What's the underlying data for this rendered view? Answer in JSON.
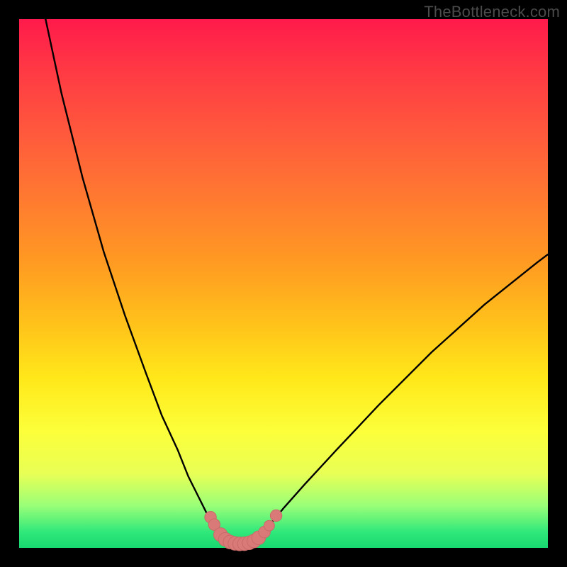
{
  "watermark": "TheBottleneck.com",
  "colors": {
    "frame": "#000000",
    "curve_stroke": "#000000",
    "marker_fill": "#d97a78",
    "marker_stroke": "#c96a68"
  },
  "chart_data": {
    "type": "line",
    "title": "",
    "xlabel": "",
    "ylabel": "",
    "xlim": [
      0,
      100
    ],
    "ylim": [
      0,
      100
    ],
    "grid": false,
    "legend": false,
    "series": [
      {
        "name": "left-branch",
        "x": [
          5,
          8,
          12,
          16,
          20,
          24,
          27,
          30,
          32,
          34,
          35.5,
          37,
          38.2,
          39.2,
          40
        ],
        "y": [
          100,
          86,
          70,
          56,
          44,
          33,
          25,
          18.5,
          13.5,
          9.5,
          6.5,
          4.3,
          2.8,
          1.6,
          0.8
        ]
      },
      {
        "name": "valley-floor",
        "x": [
          40,
          41,
          42,
          43,
          44
        ],
        "y": [
          0.8,
          0.5,
          0.4,
          0.5,
          0.8
        ]
      },
      {
        "name": "right-branch",
        "x": [
          44,
          45.5,
          47.5,
          50,
          54,
          60,
          68,
          78,
          88,
          98,
          100
        ],
        "y": [
          0.8,
          2.2,
          4.5,
          7.5,
          12,
          18.5,
          27,
          37,
          46,
          54,
          55.5
        ]
      }
    ],
    "markers": {
      "name": "valley-markers",
      "points": [
        {
          "x": 36.2,
          "y": 5.8,
          "r": 1.1
        },
        {
          "x": 36.9,
          "y": 4.4,
          "r": 1.1
        },
        {
          "x": 38.1,
          "y": 2.5,
          "r": 1.3
        },
        {
          "x": 39.0,
          "y": 1.6,
          "r": 1.3
        },
        {
          "x": 39.9,
          "y": 1.1,
          "r": 1.3
        },
        {
          "x": 40.8,
          "y": 0.85,
          "r": 1.3
        },
        {
          "x": 41.7,
          "y": 0.75,
          "r": 1.3
        },
        {
          "x": 42.6,
          "y": 0.78,
          "r": 1.3
        },
        {
          "x": 43.5,
          "y": 0.95,
          "r": 1.3
        },
        {
          "x": 44.4,
          "y": 1.3,
          "r": 1.3
        },
        {
          "x": 45.3,
          "y": 1.9,
          "r": 1.3
        },
        {
          "x": 46.4,
          "y": 3.0,
          "r": 1.1
        },
        {
          "x": 47.3,
          "y": 4.2,
          "r": 1.0
        },
        {
          "x": 48.6,
          "y": 6.1,
          "r": 1.1
        }
      ]
    }
  }
}
